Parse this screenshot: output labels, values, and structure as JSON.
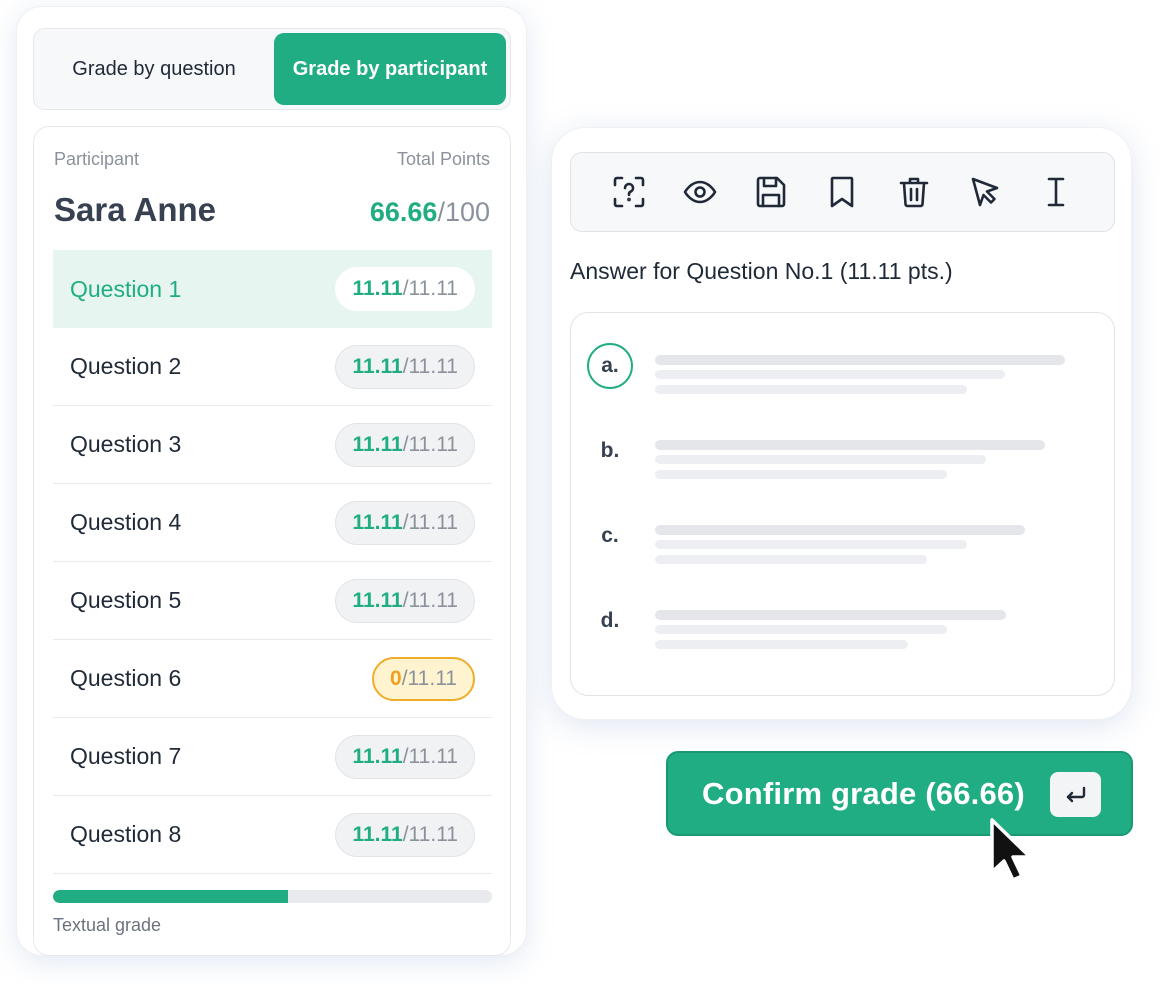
{
  "grading_modes": {
    "by_question": "Grade by question",
    "by_participant": "Grade by participant",
    "active": "by_participant"
  },
  "participant_panel": {
    "participant_header": "Participant",
    "total_points_header": "Total Points",
    "name": "Sara Anne",
    "total_score": "66.66",
    "total_max": "/100"
  },
  "questions": [
    {
      "label": "Question 1",
      "score": "11.11",
      "max": "/11.11",
      "active": true,
      "status": "full"
    },
    {
      "label": "Question 2",
      "score": "11.11",
      "max": "/11.11",
      "active": false,
      "status": "full"
    },
    {
      "label": "Question 3",
      "score": "11.11",
      "max": "/11.11",
      "active": false,
      "status": "full"
    },
    {
      "label": "Question 4",
      "score": "11.11",
      "max": "/11.11",
      "active": false,
      "status": "full"
    },
    {
      "label": "Question 5",
      "score": "11.11",
      "max": "/11.11",
      "active": false,
      "status": "full"
    },
    {
      "label": "Question 6",
      "score": "0",
      "max": "/11.11",
      "active": false,
      "status": "zero"
    },
    {
      "label": "Question 7",
      "score": "11.11",
      "max": "/11.11",
      "active": false,
      "status": "full"
    },
    {
      "label": "Question 8",
      "score": "11.11",
      "max": "/11.11",
      "active": false,
      "status": "full"
    }
  ],
  "progress": {
    "fraction": 0.535
  },
  "textual_grade_label": "Textual grade",
  "toolbar_icons": [
    "question-scan-icon",
    "eye-icon",
    "save-icon",
    "bookmark-icon",
    "trash-icon",
    "pointer-icon",
    "text-cursor-icon"
  ],
  "answer_panel": {
    "title": "Answer for Question No.1 (11.11 pts.)",
    "options": [
      {
        "letter": "a.",
        "selected": true
      },
      {
        "letter": "b.",
        "selected": false
      },
      {
        "letter": "c.",
        "selected": false
      },
      {
        "letter": "d.",
        "selected": false
      }
    ]
  },
  "confirm_button": {
    "label": "Confirm grade (66.66)",
    "shortcut_icon": "enter-key-icon"
  },
  "colors": {
    "accent": "#21ad83",
    "accent_tint": "#e6f5ef",
    "warning": "#f0ad2c",
    "warning_bg": "#fff4cf",
    "muted_text": "#8b929c"
  }
}
